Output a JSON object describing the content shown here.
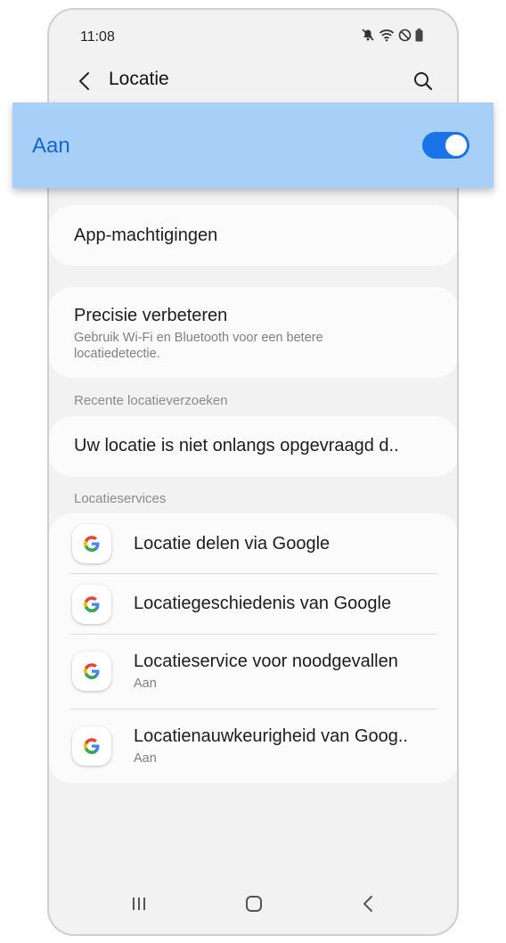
{
  "status_bar": {
    "time": "11:08"
  },
  "header": {
    "title": "Locatie"
  },
  "master_switch": {
    "label": "Aan",
    "state": "on",
    "accent": "#1a73e8"
  },
  "app_permissions": {
    "title": "App-machtigingen"
  },
  "precision": {
    "title": "Precisie verbeteren",
    "subtitle": "Gebruik Wi-Fi en Bluetooth voor een betere locatiedetectie."
  },
  "recent": {
    "section_label": "Recente locatieverzoeken",
    "message": "Uw locatie is niet onlangs opgevraagd d.."
  },
  "services": {
    "section_label": "Locatieservices",
    "items": [
      {
        "title": "Locatie delen via Google",
        "subtitle": "",
        "icon": "google-icon"
      },
      {
        "title": "Locatiegeschiedenis van Google",
        "subtitle": "",
        "icon": "google-icon"
      },
      {
        "title": "Locatieservice voor noodgevallen",
        "subtitle": "Aan",
        "icon": "google-icon"
      },
      {
        "title": "Locatienauwkeurigheid van Goog..",
        "subtitle": "Aan",
        "icon": "google-icon"
      }
    ]
  }
}
